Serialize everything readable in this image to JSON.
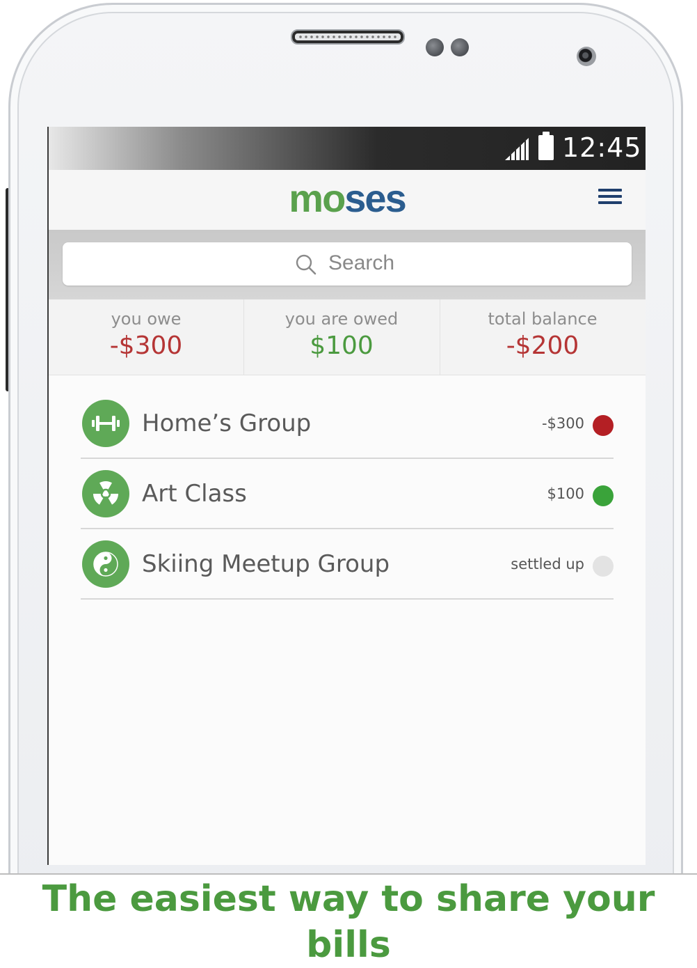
{
  "status_bar": {
    "time": "12:45",
    "signal_icon": "signal-icon",
    "battery_icon": "battery-icon"
  },
  "header": {
    "logo_part1": "mo",
    "logo_part2": "ses",
    "menu_icon": "hamburger-menu-icon",
    "colors": {
      "logo_green": "#5aa14d",
      "logo_blue": "#2b5d8f"
    }
  },
  "search": {
    "placeholder": "Search",
    "icon": "search-icon"
  },
  "summary": {
    "you_owe_label": "you owe",
    "you_owe_value": "-$300",
    "owed_label": "you are owed",
    "owed_value": "$100",
    "total_label": "total balance",
    "total_value": "-$200"
  },
  "groups": [
    {
      "name": "Home’s Group",
      "amount": "-$300",
      "status_color": "#b41f24",
      "icon": "dumbbell-icon"
    },
    {
      "name": "Art Class",
      "amount": "$100",
      "status_color": "#3aa33a",
      "icon": "radiation-icon"
    },
    {
      "name": "Skiing Meetup Group",
      "amount": "settled up",
      "status_color": "#e3e3e3",
      "icon": "yin-yang-icon"
    }
  ],
  "tagline": "The easiest way to share your bills",
  "colors": {
    "accent_green": "#4b9a3f",
    "negative_red": "#b53535"
  }
}
